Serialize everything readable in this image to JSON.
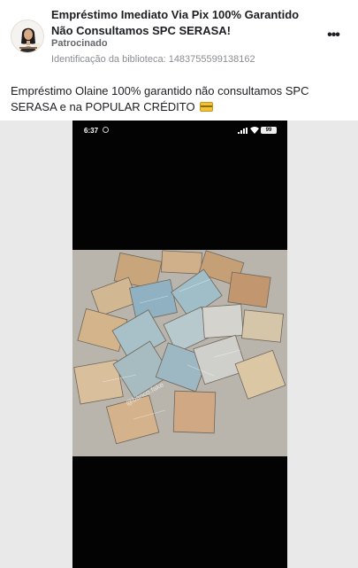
{
  "post": {
    "title": "Empréstimo Imediato Via Pix 100% Garantido Não Consultamos SPC SERASA!",
    "sponsored_label": "Patrocinado",
    "library_id": "Identificação da biblioteca: 1483755599138162",
    "more_icon": "more-options-icon",
    "body_text": "Empréstimo Olaine 100% garantido não consultamos SPC SERASA e na POPULAR CRÉDITO",
    "body_icon": "credit-card-icon"
  },
  "media": {
    "status_time": "6:37",
    "battery_level": "99",
    "watermark": "@banco.fake",
    "colors": {
      "background": "#e9e9e9",
      "phone": "#030303",
      "note_tan": "#c8a47c",
      "note_blue": "#8fb1c1",
      "note_light": "#d8d0c1"
    }
  }
}
